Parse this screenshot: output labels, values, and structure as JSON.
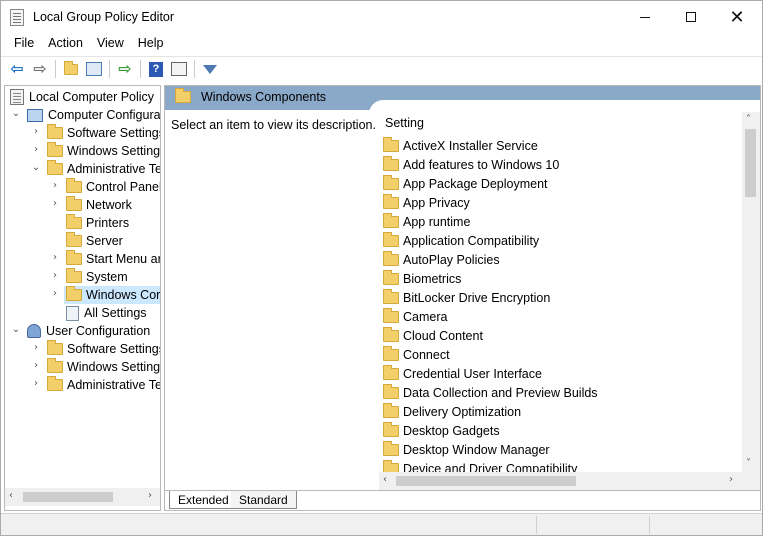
{
  "window": {
    "title": "Local Group Policy Editor"
  },
  "menubar": {
    "items": [
      "File",
      "Action",
      "View",
      "Help"
    ]
  },
  "toolbar": {
    "buttons": [
      "back-icon",
      "forward-icon",
      "up-folder-icon",
      "show-hide-tree-icon",
      "export-list-icon",
      "help-icon",
      "properties-icon",
      "filter-icon"
    ]
  },
  "tree": {
    "root": "Local Computer Policy",
    "computer_config": "Computer Configura",
    "cc_software": "Software Settings",
    "cc_windows": "Windows Setting",
    "cc_admin": "Administrative Te",
    "at_control_panel": "Control Panel",
    "at_network": "Network",
    "at_printers": "Printers",
    "at_server": "Server",
    "at_start_menu": "Start Menu ar",
    "at_system": "System",
    "at_windows_components": "Windows Cor",
    "at_all_settings": "All Settings",
    "user_config": "User Configuration",
    "uc_software": "Software Settings",
    "uc_windows": "Windows Setting",
    "uc_admin": "Administrative Te"
  },
  "details": {
    "header_title": "Windows Components",
    "description": "Select an item to view its description.",
    "column_header": "Setting",
    "items": [
      "ActiveX Installer Service",
      "Add features to Windows 10",
      "App Package Deployment",
      "App Privacy",
      "App runtime",
      "Application Compatibility",
      "AutoPlay Policies",
      "Biometrics",
      "BitLocker Drive Encryption",
      "Camera",
      "Cloud Content",
      "Connect",
      "Credential User Interface",
      "Data Collection and Preview Builds",
      "Delivery Optimization",
      "Desktop Gadgets",
      "Desktop Window Manager",
      "Device and Driver Compatibility"
    ]
  },
  "tabs": {
    "extended": "Extended",
    "standard": "Standard"
  }
}
